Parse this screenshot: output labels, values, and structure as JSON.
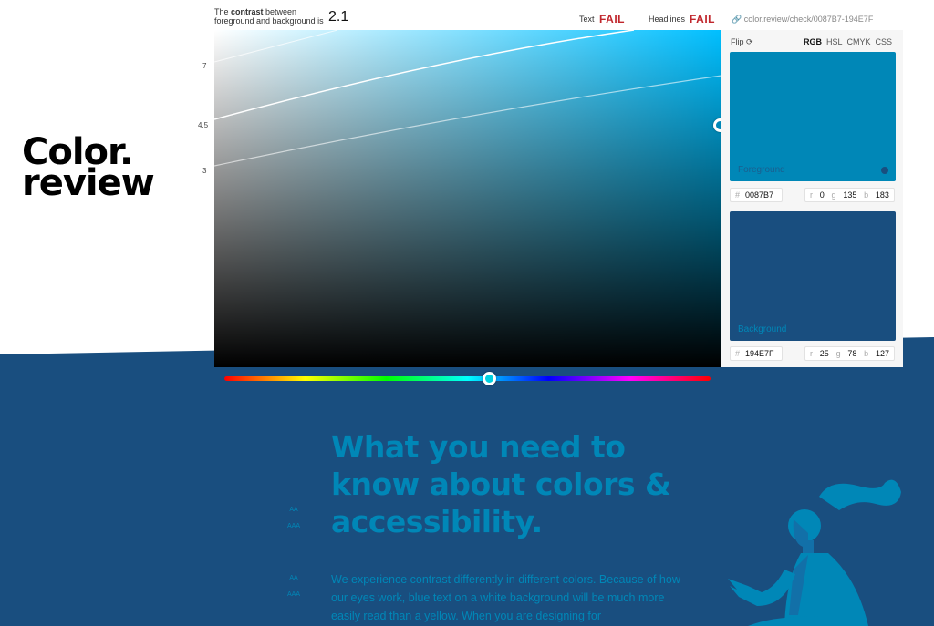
{
  "logo": {
    "line1": "Color.",
    "line2": "review"
  },
  "header": {
    "ratio_prefix": "The ",
    "ratio_bold": "contrast",
    "ratio_suffix": " between",
    "ratio_line2": "foreground and background is",
    "ratio_value": "2.1",
    "text_label": "Text",
    "text_status": "FAIL",
    "headlines_label": "Headlines",
    "headlines_status": "FAIL",
    "link": "color.review/check/0087B7-194E7F"
  },
  "axis": {
    "ticks": [
      "7",
      "4.5",
      "3"
    ]
  },
  "hue": {
    "value_fraction": 0.54
  },
  "panel": {
    "flip": "Flip",
    "modes": [
      "RGB",
      "HSL",
      "CMYK",
      "CSS"
    ],
    "active_mode": "RGB",
    "foreground": {
      "label": "Foreground",
      "hex": "0087B7",
      "r": "0",
      "g": "135",
      "b": "183",
      "color": "#0087B7"
    },
    "background": {
      "label": "Background",
      "hex": "194E7F",
      "r": "25",
      "g": "78",
      "b": "127",
      "color": "#194E7F"
    }
  },
  "article": {
    "headline_lines": [
      "What you need to",
      "know about colors &",
      "accessibility."
    ],
    "paragraph": "We experience contrast differently in different colors. Because of how our eyes work, blue text on a white background will be much more easily read than a yellow. When you are designing for",
    "badges": [
      "AA",
      "AAA"
    ]
  }
}
